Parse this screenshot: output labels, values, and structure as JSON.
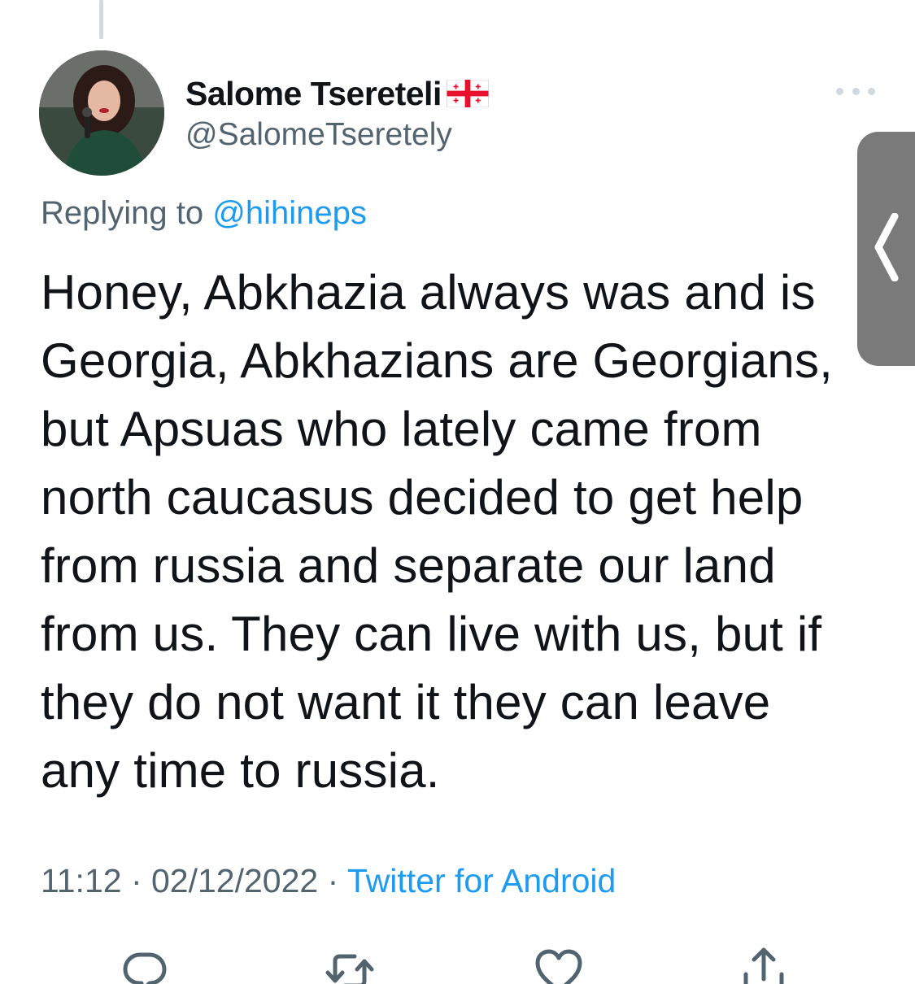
{
  "author": {
    "display_name": "Salome Tsereteli",
    "handle": "@SalomeTseretely",
    "avatar_icon": "profile-photo",
    "flag_icon": "georgia-flag-icon"
  },
  "reply": {
    "prefix": "Replying to ",
    "mention": "@hihineps"
  },
  "tweet": {
    "text": "Honey, Abkhazia always was and is\nGeorgia, Abkhazians are Georgians,\nbut Apsuas who lately came from\nnorth caucasus decided to get help\nfrom russia and separate our land\nfrom us. They can live with us, but if\nthey do not want it they can leave\nany time to russia."
  },
  "meta": {
    "time": "11:12",
    "separator": " · ",
    "date": "02/12/2022",
    "source": "Twitter for Android"
  },
  "actions": [
    {
      "name": "reply",
      "icon": "reply-icon"
    },
    {
      "name": "retweet",
      "icon": "retweet-icon"
    },
    {
      "name": "like",
      "icon": "heart-icon"
    },
    {
      "name": "share",
      "icon": "share-icon"
    }
  ],
  "colors": {
    "text": "#0f1419",
    "secondary": "#536471",
    "link": "#1d9bf0"
  }
}
